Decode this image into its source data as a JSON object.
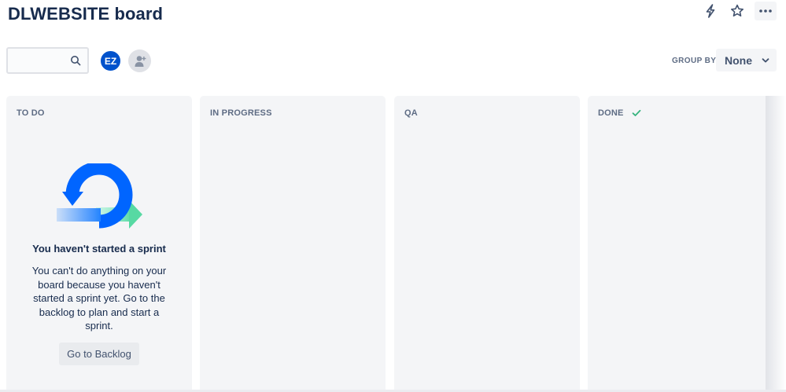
{
  "header": {
    "title": "DLWEBSITE board"
  },
  "top_actions": {
    "icons": [
      "lightning-icon",
      "star-icon",
      "more-icon"
    ]
  },
  "toolbar": {
    "search": {
      "value": "",
      "placeholder": ""
    },
    "avatar_initials": "EZ",
    "group_by_label": "GROUP BY",
    "group_by_value": "None"
  },
  "columns": [
    {
      "title": "TO DO"
    },
    {
      "title": "IN PROGRESS"
    },
    {
      "title": "QA"
    },
    {
      "title": "DONE"
    }
  ],
  "empty_state": {
    "title": "You haven't started a sprint",
    "body": "You can't do anything on your board because you haven't started a sprint yet. Go to the backlog to plan and start a sprint.",
    "button_label": "Go to Backlog"
  },
  "colors": {
    "accent": "#0052cc",
    "column_bg": "#f4f5f7",
    "done_check": "#36b37e",
    "text": "#172b4d"
  }
}
